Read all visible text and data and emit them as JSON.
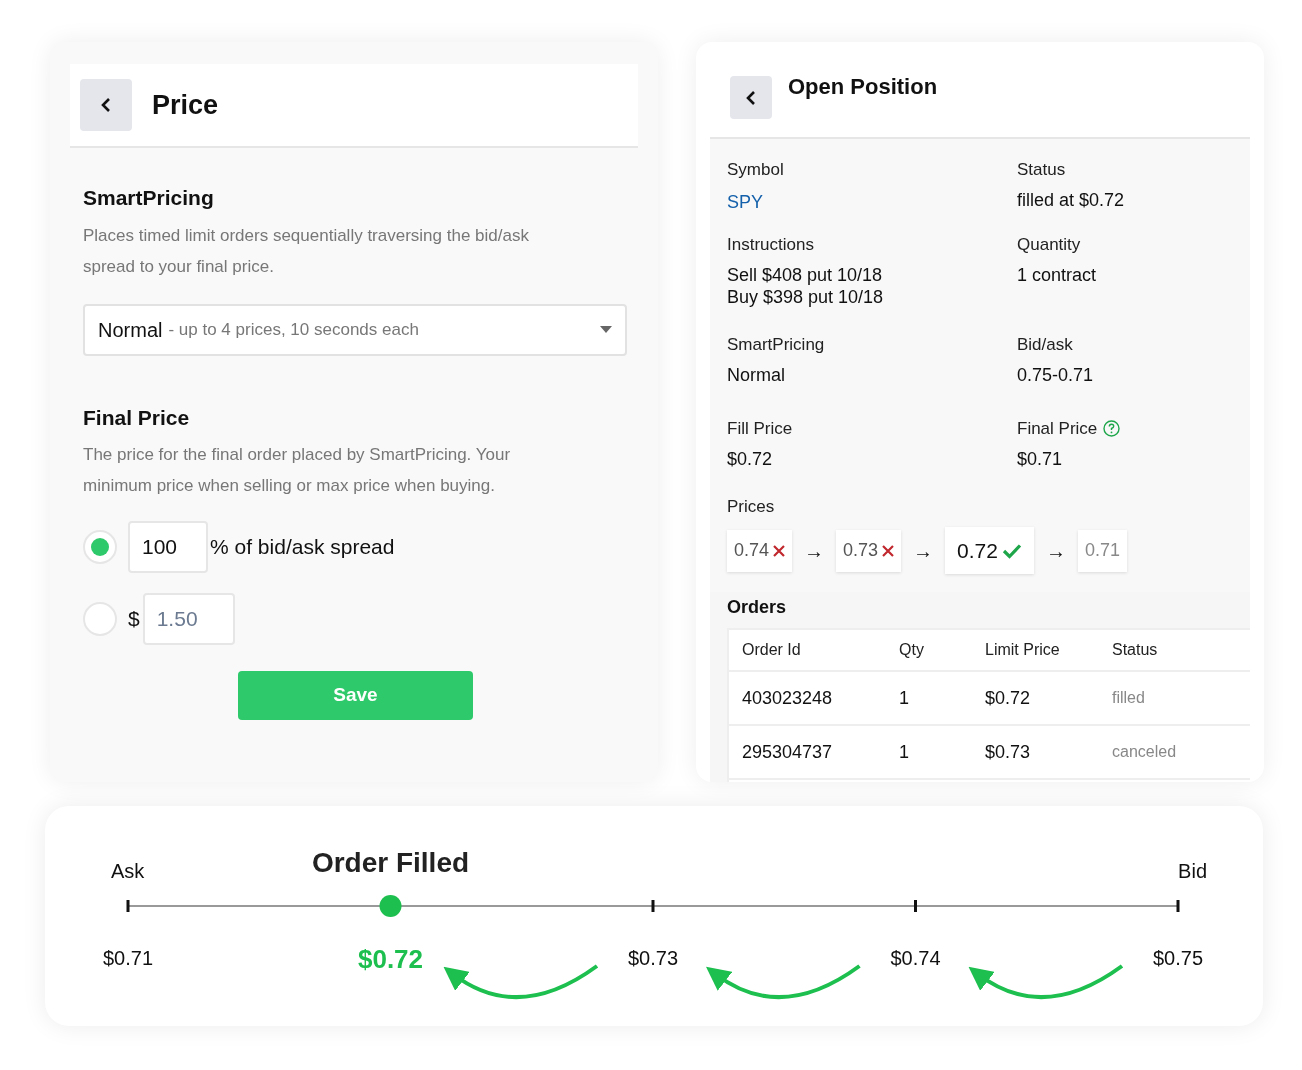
{
  "price_panel": {
    "title": "Price",
    "smart_pricing": {
      "heading": "SmartPricing",
      "description": "Places timed limit orders sequentially traversing the bid/ask spread to your final price.",
      "dropdown": {
        "value": "Normal",
        "detail": "- up to 4 prices, 10 seconds each"
      }
    },
    "final_price": {
      "heading": "Final Price",
      "description": "The price for the final order placed by SmartPricing. Your minimum price when selling or max price when buying.",
      "options": [
        {
          "kind": "percent",
          "selected": true,
          "value": "100",
          "suffix": "% of bid/ask spread"
        },
        {
          "kind": "dollar",
          "selected": false,
          "prefix": "$",
          "placeholder": "1.50"
        }
      ]
    },
    "save_button": "Save"
  },
  "position_panel": {
    "title": "Open Position",
    "fields": [
      {
        "label": "Symbol",
        "lines": [
          "SPY"
        ],
        "link": true,
        "help": false
      },
      {
        "label": "Status",
        "lines": [
          "filled at $0.72"
        ],
        "link": false,
        "help": false
      },
      {
        "label": "Instructions",
        "lines": [
          "Sell $408 put 10/18",
          "Buy $398 put 10/18"
        ],
        "link": false,
        "help": false
      },
      {
        "label": "Quantity",
        "lines": [
          "1 contract"
        ],
        "link": false,
        "help": false
      },
      {
        "label": "SmartPricing",
        "lines": [
          "Normal"
        ],
        "link": false,
        "help": false
      },
      {
        "label": "Bid/ask",
        "lines": [
          "0.75-0.71"
        ],
        "link": false,
        "help": false
      },
      {
        "label": "Fill Price",
        "lines": [
          "$0.72"
        ],
        "link": false,
        "help": false
      },
      {
        "label": "Final Price",
        "lines": [
          "$0.71"
        ],
        "link": false,
        "help": true
      }
    ],
    "prices_label": "Prices",
    "prices": [
      {
        "value": "0.74",
        "kind": "rejected"
      },
      {
        "value": "0.73",
        "kind": "rejected"
      },
      {
        "value": "0.72",
        "kind": "filled"
      },
      {
        "value": "0.71",
        "kind": "pending"
      }
    ],
    "arrow": "→",
    "orders_heading": "Orders",
    "orders": {
      "columns": [
        "Order Id",
        "Qty",
        "Limit Price",
        "Status"
      ],
      "rows": [
        [
          "403023248",
          "1",
          "$0.72",
          "filled"
        ],
        [
          "295304737",
          "1",
          "$0.73",
          "canceled"
        ]
      ]
    }
  },
  "timeline": {
    "start_label": "Ask",
    "end_label": "Bid",
    "filled_label": "Order Filled",
    "points": [
      {
        "label": "$0.71",
        "selected": false
      },
      {
        "label": "$0.72",
        "selected": true
      },
      {
        "label": "$0.73",
        "selected": false
      },
      {
        "label": "$0.74",
        "selected": false
      },
      {
        "label": "$0.75",
        "selected": false
      }
    ]
  }
}
